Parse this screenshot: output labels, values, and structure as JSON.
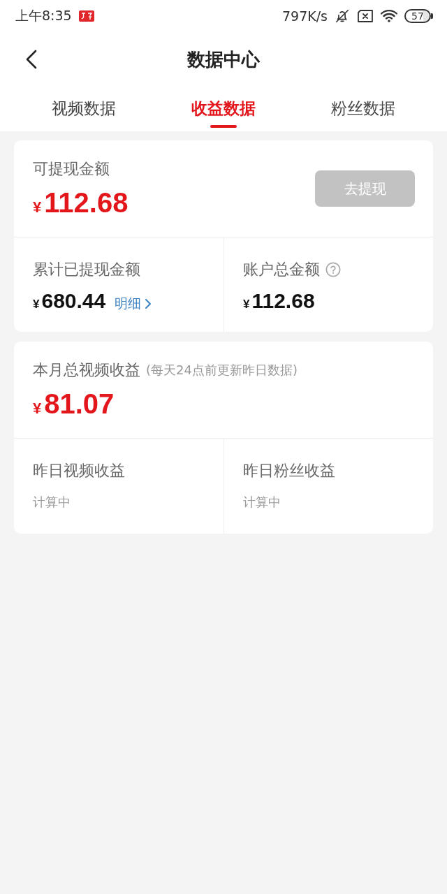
{
  "status_bar": {
    "time": "上午8:35",
    "speed": "797K/s",
    "battery": "57"
  },
  "header": {
    "title": "数据中心"
  },
  "tabs": [
    {
      "label": "视频数据",
      "selected": false
    },
    {
      "label": "收益数据",
      "selected": true
    },
    {
      "label": "粉丝数据",
      "selected": false
    }
  ],
  "balance_card": {
    "label": "可提现金额",
    "currency": "¥",
    "amount": "112.68",
    "withdraw_button": {
      "label": "去提现",
      "disabled": true
    },
    "stats": [
      {
        "label": "累计已提现金额",
        "currency": "¥",
        "amount": "680.44",
        "link": "明细",
        "help": false
      },
      {
        "label": "账户总金额",
        "currency": "¥",
        "amount": "112.68",
        "help": true
      }
    ]
  },
  "income_card": {
    "label": "本月总视频收益",
    "note": "(每天24点前更新昨日数据)",
    "currency": "¥",
    "amount": "81.07",
    "stats": [
      {
        "label": "昨日视频收益",
        "value": "计算中"
      },
      {
        "label": "昨日粉丝收益",
        "value": "计算中"
      }
    ]
  }
}
